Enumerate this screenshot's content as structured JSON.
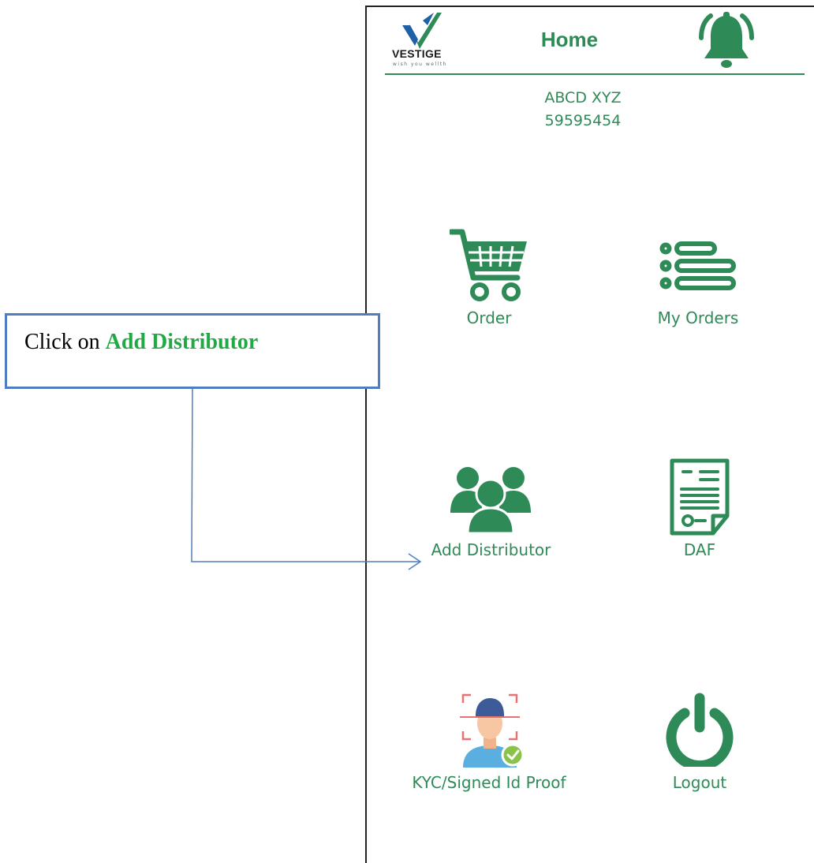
{
  "header": {
    "logo_text": "VESTIGE",
    "logo_tagline": "wish you wellth",
    "title": "Home"
  },
  "user": {
    "name": "ABCD XYZ",
    "id": "59595454"
  },
  "tiles": {
    "order": "Order",
    "my_orders": "My Orders",
    "add_distributor": "Add Distributor",
    "daf": "DAF",
    "kyc": "KYC/Signed Id Proof",
    "logout": "Logout"
  },
  "callout": {
    "prefix": "Click on ",
    "emphasis": "Add Distributor"
  },
  "colors": {
    "brand_green": "#2e8b57",
    "callout_border": "#4f7ec0",
    "callout_emphasis": "#22a845"
  }
}
